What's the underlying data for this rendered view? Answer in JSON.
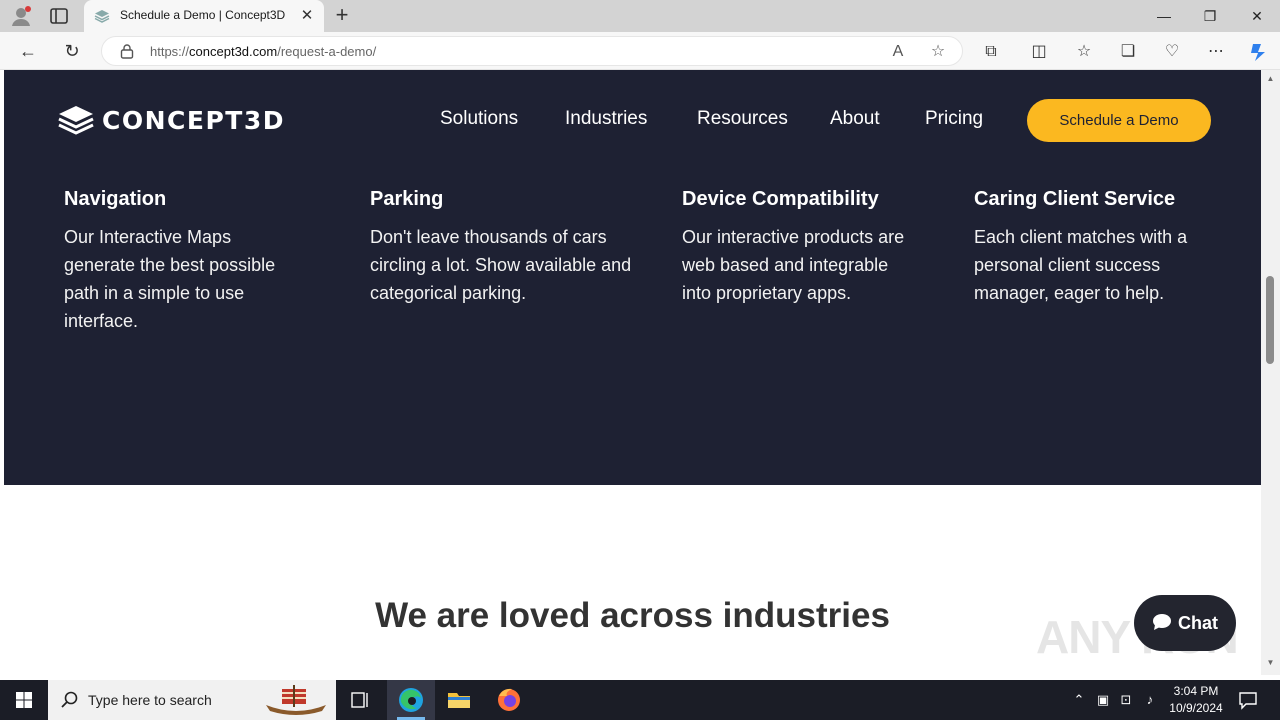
{
  "browser": {
    "tab_title": "Schedule a Demo | Concept3D",
    "url_prefix": "https://",
    "url_domain": "concept3d.com",
    "url_path": "/request-a-demo/"
  },
  "site": {
    "logo_text": "CONCEPT3D",
    "nav": [
      "Solutions",
      "Industries",
      "Resources",
      "About",
      "Pricing"
    ],
    "cta_label": "Schedule a Demo",
    "features": [
      {
        "title": "Navigation",
        "body": "Our Interactive Maps generate the best possible path in a simple to use interface."
      },
      {
        "title": "Parking",
        "body": "Don't leave thousands of cars circling a lot. Show available and categorical parking."
      },
      {
        "title": "Device Compatibility",
        "body": "Our interactive products are web based and integrable into proprietary apps."
      },
      {
        "title": "Caring Client Service",
        "body": "Each client matches with a personal client success manager, eager to help."
      }
    ],
    "section_heading": "We are loved across industries",
    "chat_label": "Chat",
    "watermark": "ANY RUN"
  },
  "taskbar": {
    "search_placeholder": "Type here to search",
    "time": "3:04 PM",
    "date": "10/9/2024"
  },
  "colors": {
    "hero_bg": "#1e2133",
    "cta_bg": "#fbb820"
  }
}
